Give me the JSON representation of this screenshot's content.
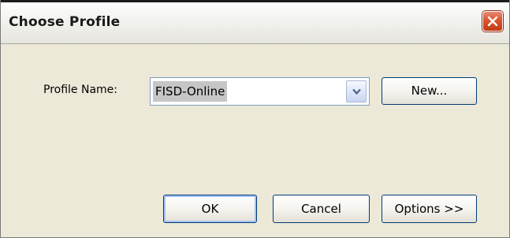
{
  "dialog": {
    "title": "Choose Profile",
    "close_icon": "close-x-icon"
  },
  "profile": {
    "label": "Profile Name:",
    "selected_value": "FISD-Online",
    "dropdown_icon": "chevron-down-icon",
    "new_button_label": "New..."
  },
  "footer": {
    "ok_label": "OK",
    "cancel_label": "Cancel",
    "options_label": "Options >>"
  },
  "colors": {
    "dialog_background": "#ece9d8",
    "close_button": "#d9542e",
    "button_border": "#003c74",
    "selection_highlight": "#c6c6c6"
  }
}
